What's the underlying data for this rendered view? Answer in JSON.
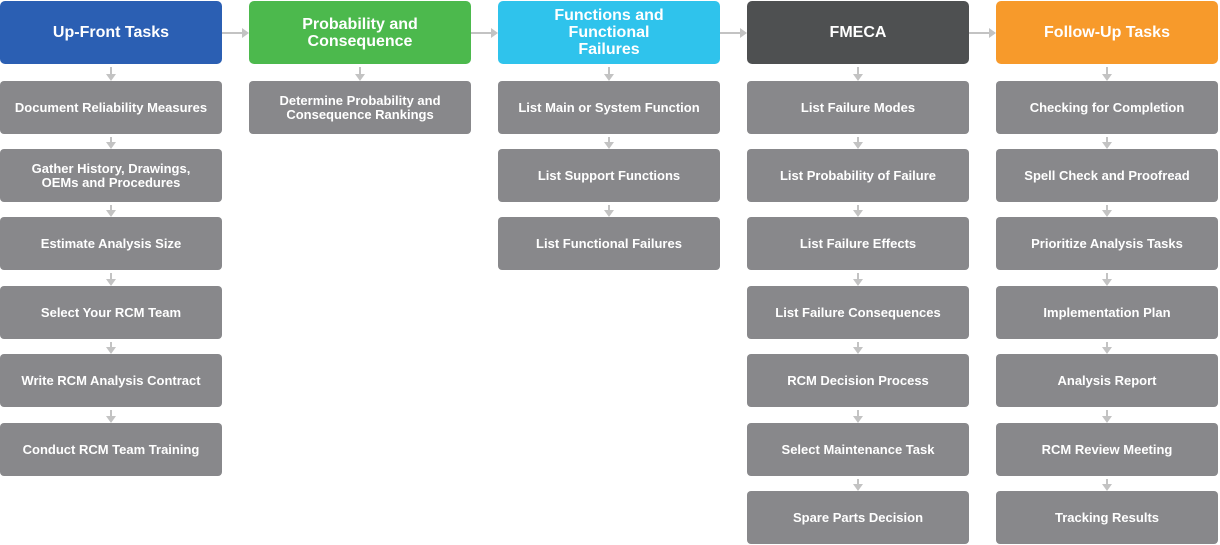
{
  "colors": {
    "box": "#88888b",
    "arrow": "#c3c3c3"
  },
  "columns": [
    {
      "title": "Up-Front Tasks",
      "color": "#2b5fb3",
      "steps": [
        "Document Reliability Measures",
        "Gather History, Drawings, OEMs and Procedures",
        "Estimate Analysis Size",
        "Select Your RCM Team",
        "Write RCM Analysis Contract",
        "Conduct RCM Team Training"
      ]
    },
    {
      "title": "Probability and Consequence",
      "color": "#4cb94d",
      "steps": [
        "Determine Probability and Consequence Rankings"
      ]
    },
    {
      "title": "Functions and Functional Failures",
      "color": "#2fc3ec",
      "steps": [
        "List Main or System Function",
        "List Support Functions",
        "List Functional Failures"
      ]
    },
    {
      "title": "FMECA",
      "color": "#4e5051",
      "steps": [
        "List Failure Modes",
        "List Probability of Failure",
        "List Failure Effects",
        "List Failure Consequences",
        "RCM Decision Process",
        "Select Maintenance Task",
        "Spare Parts Decision"
      ]
    },
    {
      "title": "Follow-Up Tasks",
      "color": "#f79a2b",
      "steps": [
        "Checking for Completion",
        "Spell Check and Proofread",
        "Prioritize Analysis Tasks",
        "Implementation Plan",
        "Analysis Report",
        "RCM Review Meeting",
        "Tracking Results"
      ]
    }
  ]
}
